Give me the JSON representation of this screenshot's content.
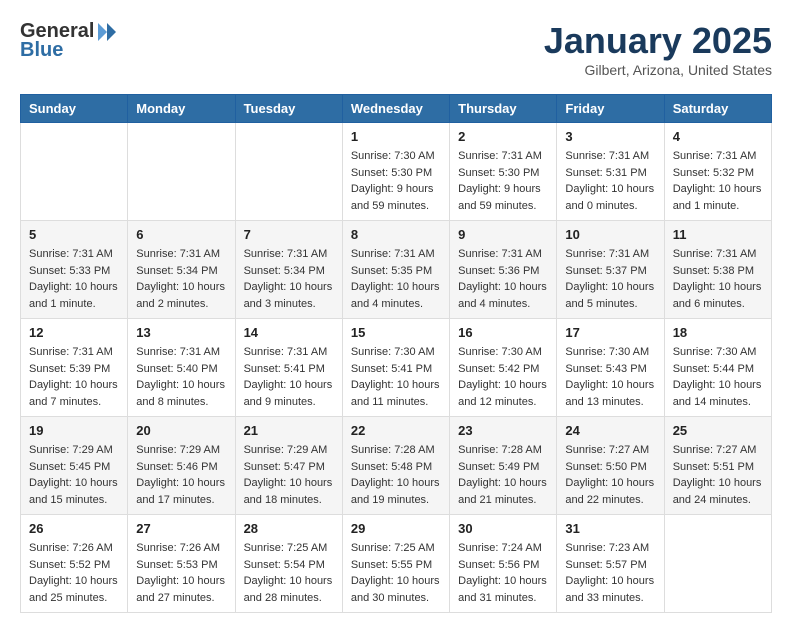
{
  "header": {
    "logo_general": "General",
    "logo_blue": "Blue",
    "title": "January 2025",
    "subtitle": "Gilbert, Arizona, United States"
  },
  "days_of_week": [
    "Sunday",
    "Monday",
    "Tuesday",
    "Wednesday",
    "Thursday",
    "Friday",
    "Saturday"
  ],
  "weeks": [
    [
      {
        "day": "",
        "info": ""
      },
      {
        "day": "",
        "info": ""
      },
      {
        "day": "",
        "info": ""
      },
      {
        "day": "1",
        "info": "Sunrise: 7:30 AM\nSunset: 5:30 PM\nDaylight: 9 hours\nand 59 minutes."
      },
      {
        "day": "2",
        "info": "Sunrise: 7:31 AM\nSunset: 5:30 PM\nDaylight: 9 hours\nand 59 minutes."
      },
      {
        "day": "3",
        "info": "Sunrise: 7:31 AM\nSunset: 5:31 PM\nDaylight: 10 hours\nand 0 minutes."
      },
      {
        "day": "4",
        "info": "Sunrise: 7:31 AM\nSunset: 5:32 PM\nDaylight: 10 hours\nand 1 minute."
      }
    ],
    [
      {
        "day": "5",
        "info": "Sunrise: 7:31 AM\nSunset: 5:33 PM\nDaylight: 10 hours\nand 1 minute."
      },
      {
        "day": "6",
        "info": "Sunrise: 7:31 AM\nSunset: 5:34 PM\nDaylight: 10 hours\nand 2 minutes."
      },
      {
        "day": "7",
        "info": "Sunrise: 7:31 AM\nSunset: 5:34 PM\nDaylight: 10 hours\nand 3 minutes."
      },
      {
        "day": "8",
        "info": "Sunrise: 7:31 AM\nSunset: 5:35 PM\nDaylight: 10 hours\nand 4 minutes."
      },
      {
        "day": "9",
        "info": "Sunrise: 7:31 AM\nSunset: 5:36 PM\nDaylight: 10 hours\nand 4 minutes."
      },
      {
        "day": "10",
        "info": "Sunrise: 7:31 AM\nSunset: 5:37 PM\nDaylight: 10 hours\nand 5 minutes."
      },
      {
        "day": "11",
        "info": "Sunrise: 7:31 AM\nSunset: 5:38 PM\nDaylight: 10 hours\nand 6 minutes."
      }
    ],
    [
      {
        "day": "12",
        "info": "Sunrise: 7:31 AM\nSunset: 5:39 PM\nDaylight: 10 hours\nand 7 minutes."
      },
      {
        "day": "13",
        "info": "Sunrise: 7:31 AM\nSunset: 5:40 PM\nDaylight: 10 hours\nand 8 minutes."
      },
      {
        "day": "14",
        "info": "Sunrise: 7:31 AM\nSunset: 5:41 PM\nDaylight: 10 hours\nand 9 minutes."
      },
      {
        "day": "15",
        "info": "Sunrise: 7:30 AM\nSunset: 5:41 PM\nDaylight: 10 hours\nand 11 minutes."
      },
      {
        "day": "16",
        "info": "Sunrise: 7:30 AM\nSunset: 5:42 PM\nDaylight: 10 hours\nand 12 minutes."
      },
      {
        "day": "17",
        "info": "Sunrise: 7:30 AM\nSunset: 5:43 PM\nDaylight: 10 hours\nand 13 minutes."
      },
      {
        "day": "18",
        "info": "Sunrise: 7:30 AM\nSunset: 5:44 PM\nDaylight: 10 hours\nand 14 minutes."
      }
    ],
    [
      {
        "day": "19",
        "info": "Sunrise: 7:29 AM\nSunset: 5:45 PM\nDaylight: 10 hours\nand 15 minutes."
      },
      {
        "day": "20",
        "info": "Sunrise: 7:29 AM\nSunset: 5:46 PM\nDaylight: 10 hours\nand 17 minutes."
      },
      {
        "day": "21",
        "info": "Sunrise: 7:29 AM\nSunset: 5:47 PM\nDaylight: 10 hours\nand 18 minutes."
      },
      {
        "day": "22",
        "info": "Sunrise: 7:28 AM\nSunset: 5:48 PM\nDaylight: 10 hours\nand 19 minutes."
      },
      {
        "day": "23",
        "info": "Sunrise: 7:28 AM\nSunset: 5:49 PM\nDaylight: 10 hours\nand 21 minutes."
      },
      {
        "day": "24",
        "info": "Sunrise: 7:27 AM\nSunset: 5:50 PM\nDaylight: 10 hours\nand 22 minutes."
      },
      {
        "day": "25",
        "info": "Sunrise: 7:27 AM\nSunset: 5:51 PM\nDaylight: 10 hours\nand 24 minutes."
      }
    ],
    [
      {
        "day": "26",
        "info": "Sunrise: 7:26 AM\nSunset: 5:52 PM\nDaylight: 10 hours\nand 25 minutes."
      },
      {
        "day": "27",
        "info": "Sunrise: 7:26 AM\nSunset: 5:53 PM\nDaylight: 10 hours\nand 27 minutes."
      },
      {
        "day": "28",
        "info": "Sunrise: 7:25 AM\nSunset: 5:54 PM\nDaylight: 10 hours\nand 28 minutes."
      },
      {
        "day": "29",
        "info": "Sunrise: 7:25 AM\nSunset: 5:55 PM\nDaylight: 10 hours\nand 30 minutes."
      },
      {
        "day": "30",
        "info": "Sunrise: 7:24 AM\nSunset: 5:56 PM\nDaylight: 10 hours\nand 31 minutes."
      },
      {
        "day": "31",
        "info": "Sunrise: 7:23 AM\nSunset: 5:57 PM\nDaylight: 10 hours\nand 33 minutes."
      },
      {
        "day": "",
        "info": ""
      }
    ]
  ]
}
